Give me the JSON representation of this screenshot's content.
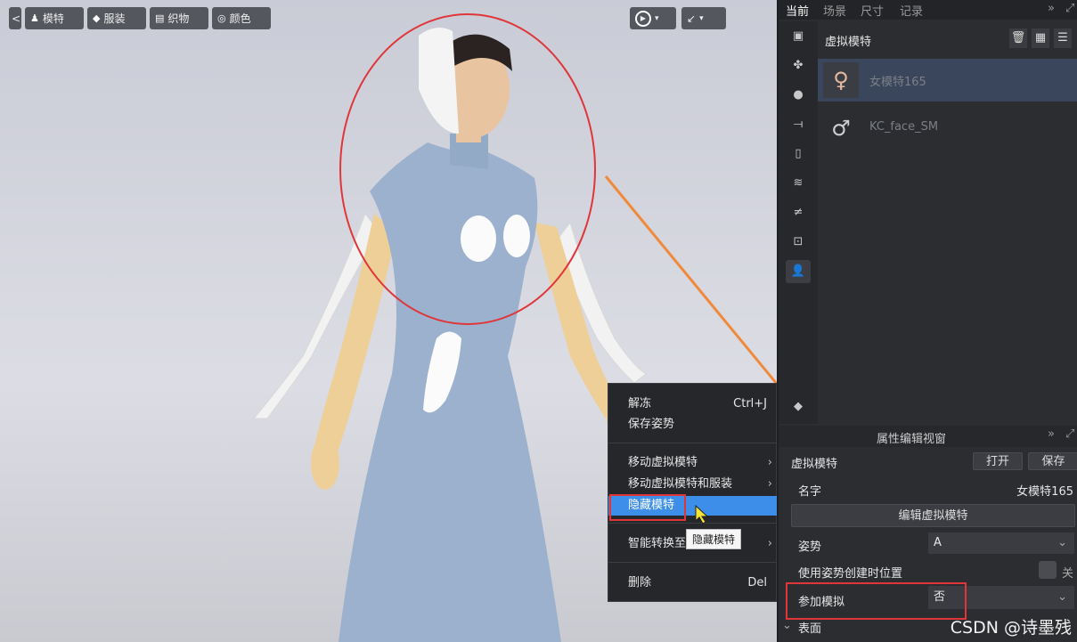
{
  "toolbar": {
    "back": "<",
    "model": "模特",
    "garment": "服装",
    "fabric": "织物",
    "color": "颜色",
    "play": "▶",
    "pointer": "↙"
  },
  "context_menu": {
    "unfreeze": "解冻",
    "unfreeze_shortcut": "Ctrl+J",
    "save_pose": "保存姿势",
    "move_avatar": "移动虚拟模特",
    "move_avatar_garment": "移动虚拟模特和服装",
    "hide_avatar": "隐藏模特",
    "smart_convert": "智能转换至",
    "delete": "删除",
    "delete_shortcut": "Del"
  },
  "tooltip": "隐藏模特",
  "right_panel": {
    "tabs": [
      "当前",
      "场景",
      "尺寸",
      "记录"
    ],
    "section_title": "虚拟模特",
    "items": [
      {
        "name": "女模特165"
      },
      {
        "name": "KC_face_SM"
      }
    ]
  },
  "property_panel": {
    "title": "属性编辑视窗",
    "object_type": "虚拟模特",
    "open_button": "打开",
    "save_button": "保存",
    "name_label": "名字",
    "name_value": "女模特165",
    "edit_avatar_button": "编辑虚拟模特",
    "pose_label": "姿势",
    "pose_value": "A",
    "use_pose_label": "使用姿势创建时位置",
    "use_pose_value": "关",
    "simulate_label": "参加模拟",
    "simulate_value": "否",
    "surface_label": "表面"
  },
  "watermark": "CSDN @诗墨残",
  "colors": {
    "accent": "#3d8ee8",
    "highlight_red": "#e0363a",
    "arrow_orange": "#f08a3a"
  }
}
